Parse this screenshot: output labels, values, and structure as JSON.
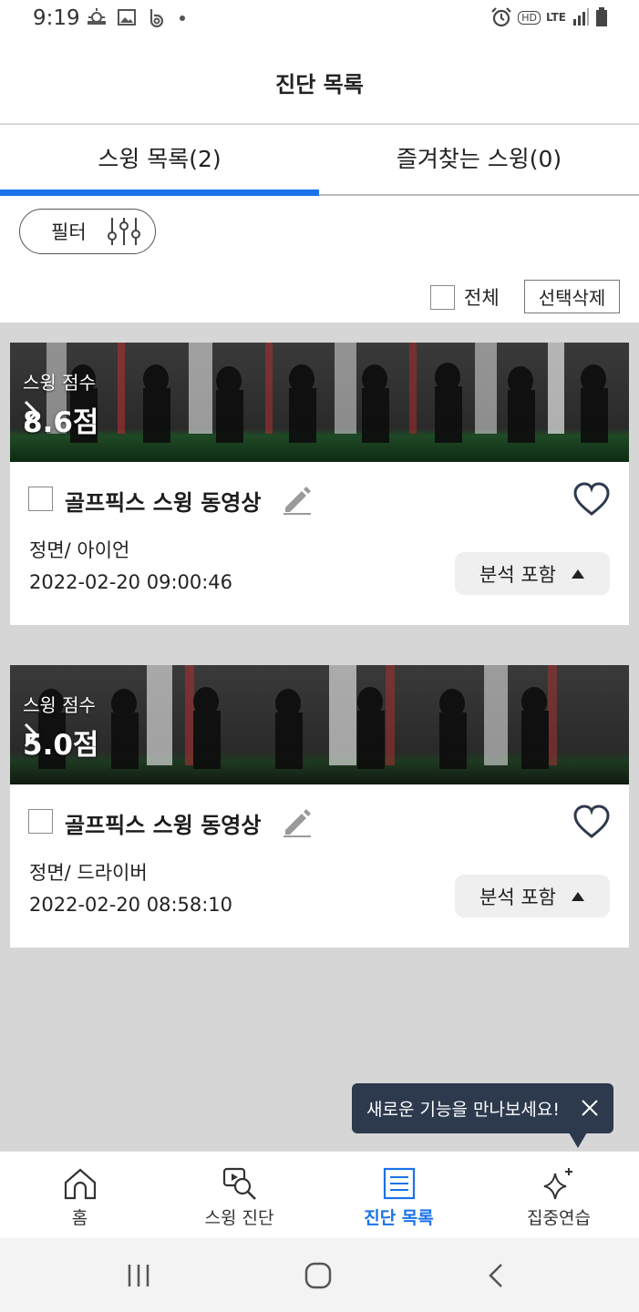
{
  "status_bar": {
    "time": "9:19",
    "left_icons": [
      "weather-icon",
      "image-icon",
      "app-b-icon",
      "dot-icon"
    ],
    "right_icons": [
      "alarm-icon",
      "hd-icon",
      "lte-icon",
      "signal-icon",
      "battery-icon"
    ],
    "hd_label": "HD",
    "lte_label": "LTE"
  },
  "header": {
    "title": "진단 목록"
  },
  "tabs": [
    {
      "label": "스윙 목록(2)",
      "active": true
    },
    {
      "label": "즐겨찾는 스윙(0)",
      "active": false
    }
  ],
  "toolbar": {
    "filter_label": "필터",
    "select_all_label": "전체",
    "delete_label": "선택삭제"
  },
  "swings": [
    {
      "score_label": "스윙 점수",
      "score": "8.6점",
      "title": "골프픽스 스윙 동영상",
      "meta": "정면/ 아이언",
      "date": "2022-02-20 09:00:46",
      "analysis_label": "분석 포함",
      "favorite": false
    },
    {
      "score_label": "스윙 점수",
      "score": "5.0점",
      "title": "골프픽스 스윙 동영상",
      "meta": "정면/ 드라이버",
      "date": "2022-02-20 08:58:10",
      "analysis_label": "분석 포함",
      "favorite": false
    }
  ],
  "tooltip": {
    "text": "새로운 기능을 만나보세요!"
  },
  "bottom_nav": [
    {
      "label": "홈",
      "icon": "home-icon",
      "active": false
    },
    {
      "label": "스윙 진단",
      "icon": "video-search-icon",
      "active": false
    },
    {
      "label": "진단 목록",
      "icon": "list-icon",
      "active": true
    },
    {
      "label": "집중연습",
      "icon": "sparkle-icon",
      "active": false
    }
  ],
  "colors": {
    "accent": "#1a73e8",
    "tooltip_bg": "#2d3a4e",
    "page_bg": "#d6d6d6"
  }
}
